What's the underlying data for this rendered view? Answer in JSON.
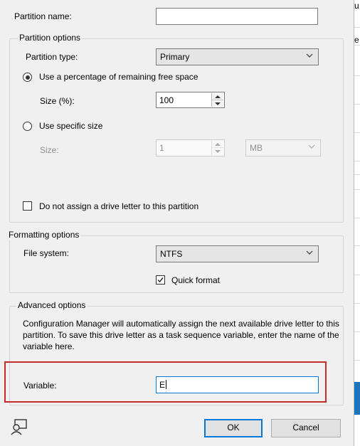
{
  "partition_name": {
    "label": "Partition name:",
    "value": ""
  },
  "partition_options": {
    "title": "Partition options",
    "type_label": "Partition type:",
    "type_value": "Primary",
    "pct_radio_label": "Use a percentage of remaining free space",
    "pct_selected": true,
    "size_pct_label": "Size (%):",
    "size_pct_value": "100",
    "specific_radio_label": "Use specific size",
    "size_label": "Size:",
    "size_value": "1",
    "size_unit": "MB",
    "no_letter_label": "Do not assign a drive letter to this partition",
    "no_letter_checked": false
  },
  "formatting_options": {
    "title": "Formatting options",
    "fs_label": "File system:",
    "fs_value": "NTFS",
    "quick_format_label": "Quick format",
    "quick_format_checked": true
  },
  "advanced_options": {
    "title": "Advanced options",
    "description": "Configuration Manager will automatically assign the next available drive letter to this partition. To save this drive letter as a task sequence variable, enter the name of the variable here.",
    "variable_label": "Variable:",
    "variable_value": "E"
  },
  "footer": {
    "ok_label": "OK",
    "cancel_label": "Cancel"
  },
  "background_window": {
    "edge_chars": [
      "u",
      "e"
    ]
  },
  "colors": {
    "dialog_bg": "#f0f0f0",
    "highlight": "#c72a2a",
    "focus_blue": "#0078d7"
  }
}
